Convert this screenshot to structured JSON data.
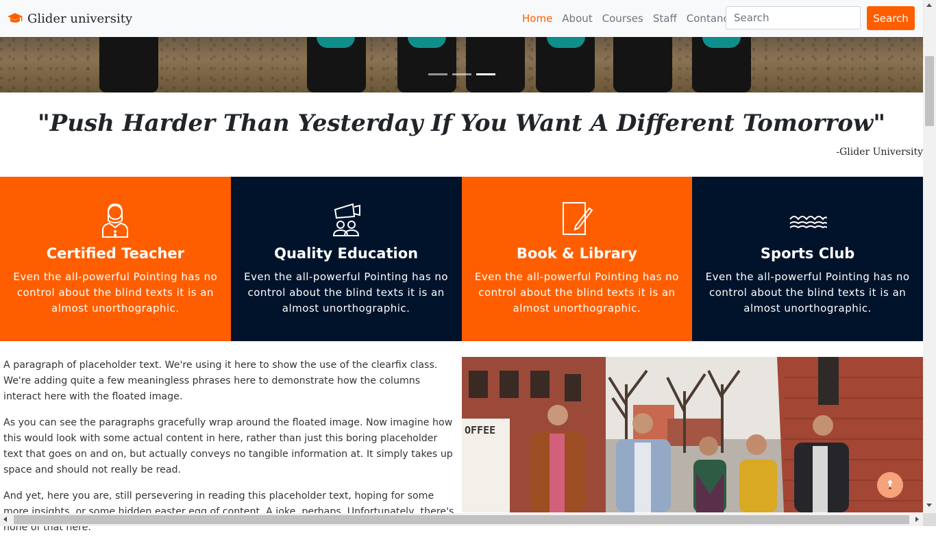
{
  "colors": {
    "accent": "#ff5e00",
    "navy": "#00132b",
    "navbar_bg": "#f8f9fa"
  },
  "navbar": {
    "brand_icon": "graduation-cap-icon",
    "brand": "Glider university",
    "links": [
      {
        "label": "Home",
        "active": true
      },
      {
        "label": "About",
        "active": false
      },
      {
        "label": "Courses",
        "active": false
      },
      {
        "label": "Staff",
        "active": false
      },
      {
        "label": "Contanct",
        "active": false
      }
    ],
    "search_placeholder": "Search",
    "search_button": "Search"
  },
  "hero": {
    "slide_count": 3,
    "active_slide": 3
  },
  "quote": {
    "text": "\"Push Harder Than Yesterday If You Want A Different Tomorrow\"",
    "author": "-Glider University"
  },
  "features": [
    {
      "icon": "teacher-icon",
      "title": "Certified Teacher",
      "text": "Even the all-powerful Pointing has no control about the blind texts it is an almost unorthographic.",
      "bg": "#ff5e00"
    },
    {
      "icon": "megaphone-icon",
      "title": "Quality Education",
      "text": "Even the all-powerful Pointing has no control about the blind texts it is an almost unorthographic.",
      "bg": "#00132b"
    },
    {
      "icon": "notepad-icon",
      "title": "Book & Library",
      "text": "Even the all-powerful Pointing has no control about the blind texts it is an almost unorthographic.",
      "bg": "#ff5e00"
    },
    {
      "icon": "swimming-icon",
      "title": "Sports Club",
      "text": "Even the all-powerful Pointing has no control about the blind texts it is an almost unorthographic.",
      "bg": "#00132b"
    }
  ],
  "content": {
    "paragraphs": [
      "A paragraph of placeholder text. We're using it here to show the use of the clearfix class. We're adding quite a few meaningless phrases here to demonstrate how the columns interact here with the floated image.",
      "As you can see the paragraphs gracefully wrap around the floated image. Now imagine how this would look with some actual content in here, rather than just this boring placeholder text that goes on and on, but actually conveys no tangible information at. It simply takes up space and should not really be read.",
      "And yet, here you are, still persevering in reading this placeholder text, hoping for some more insights, or some hidden easter egg of content. A joke, perhaps. Unfortunately, there's none of that here."
    ],
    "photo_sign": "OFFEE"
  },
  "back_to_top_icon": "arrow-up-icon"
}
